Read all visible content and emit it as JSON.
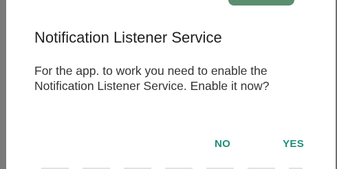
{
  "dialog": {
    "title": "Notification Listener Service",
    "message": "For the app. to work you need to enable the Notification Listener Service. Enable it now?",
    "buttons": {
      "negative_label": "NO",
      "positive_label": "YES"
    }
  },
  "colors": {
    "accent": "#1f8f79",
    "title_text": "#212121",
    "body_text": "#333333",
    "scrim": "#7a7a7a"
  }
}
